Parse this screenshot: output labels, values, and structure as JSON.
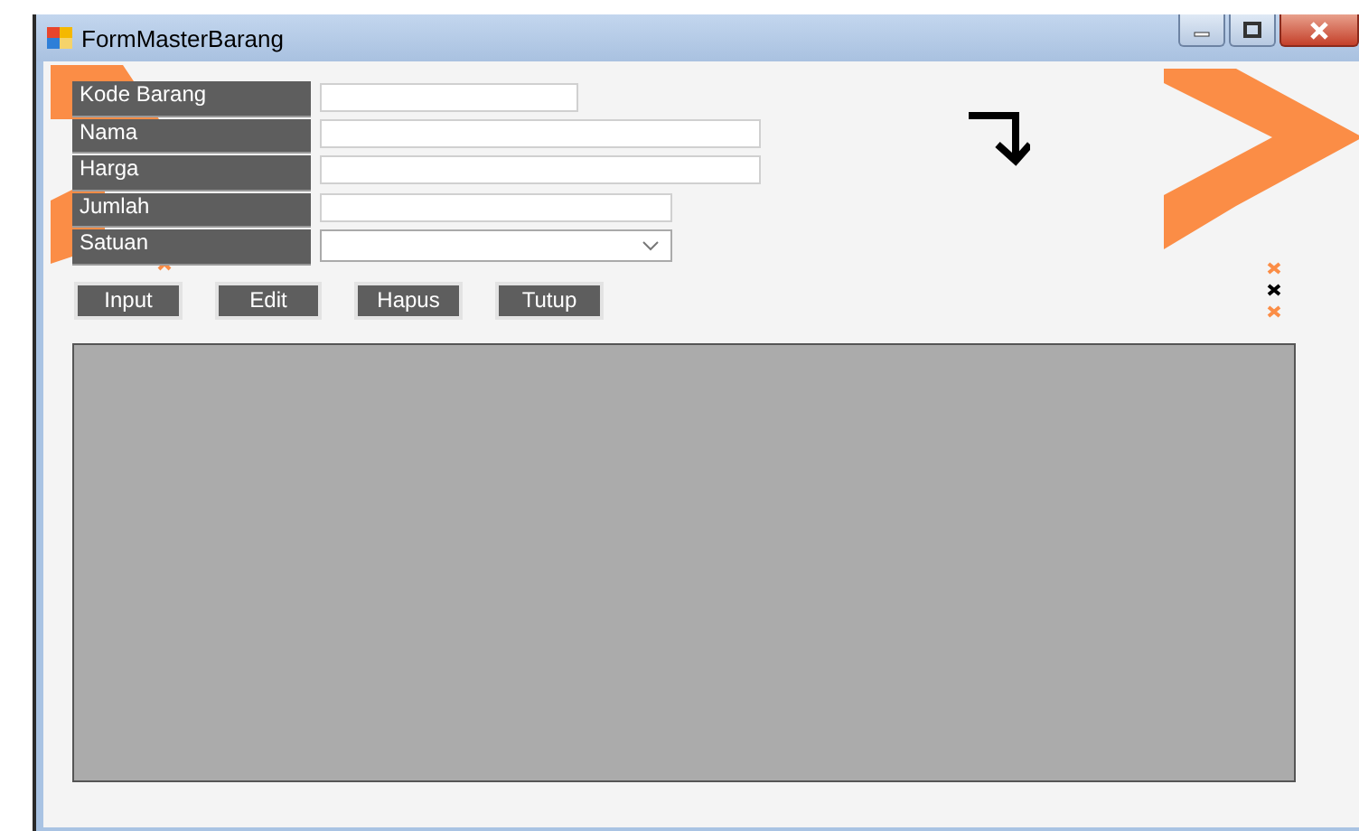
{
  "window": {
    "title": "FormMasterBarang"
  },
  "fields": [
    {
      "label": "Kode Barang",
      "kind": "text"
    },
    {
      "label": "Nama",
      "kind": "text"
    },
    {
      "label": "Harga",
      "kind": "text"
    },
    {
      "label": "Jumlah",
      "kind": "text"
    },
    {
      "label": "Satuan",
      "kind": "dropdown"
    }
  ],
  "buttons": [
    "Input",
    "Edit",
    "Hapus",
    "Tutup"
  ]
}
